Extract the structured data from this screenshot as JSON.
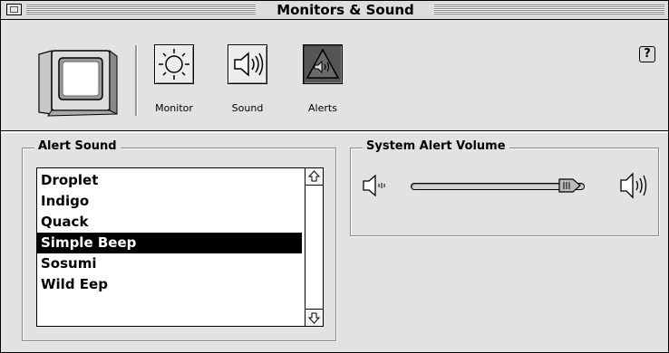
{
  "window": {
    "title": "Monitors & Sound"
  },
  "toolbar": {
    "buttons": [
      {
        "id": "monitor",
        "label": "Monitor",
        "icon": "sun-icon",
        "selected": false
      },
      {
        "id": "sound",
        "label": "Sound",
        "icon": "speaker-icon",
        "selected": false
      },
      {
        "id": "alerts",
        "label": "Alerts",
        "icon": "alert-triangle-icon",
        "selected": true
      }
    ],
    "help_label": "?"
  },
  "alert_sound": {
    "title": "Alert Sound",
    "items": [
      "Droplet",
      "Indigo",
      "Quack",
      "Simple Beep",
      "Sosumi",
      "Wild Eep"
    ],
    "selected": "Simple Beep"
  },
  "system_alert_volume": {
    "title": "System Alert Volume",
    "level": 0.96
  },
  "colors": {
    "selection_bg": "#000000",
    "panel_bg": "#e2e2e2"
  }
}
